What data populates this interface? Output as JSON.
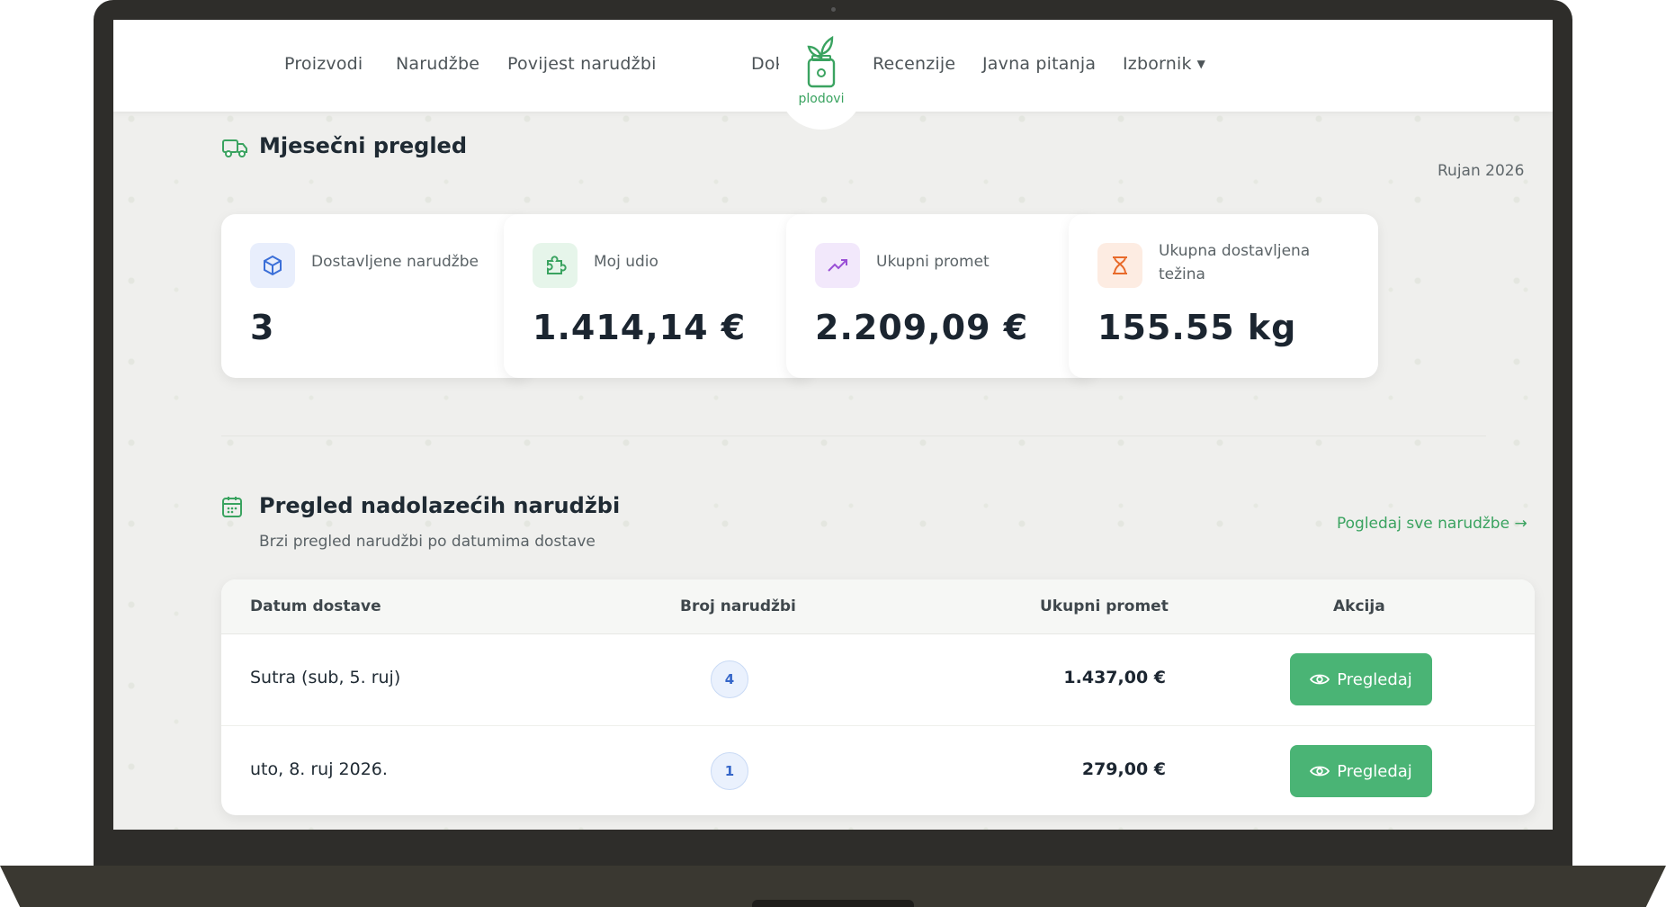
{
  "nav": {
    "items_left": [
      "Proizvodi",
      "Narudžbe",
      "Povijest narudžbi"
    ],
    "items_right": [
      "Dokumenti",
      "Recenzije",
      "Javna pitanja"
    ],
    "menu_label": "Izbornik",
    "logo_text": "plodovi"
  },
  "monthly": {
    "title": "Mjesečni pregled",
    "month": "Rujan 2026",
    "cards": [
      {
        "label": "Dostavljene narudžbe",
        "value": "3",
        "icon": "box-icon",
        "color": "#3b6fd8",
        "bg": "#e8eefc"
      },
      {
        "label": "Moj udio",
        "value": "1.414,14 €",
        "icon": "puzzle-icon",
        "color": "#3aa360",
        "bg": "#e6f5ea"
      },
      {
        "label": "Ukupni promet",
        "value": "2.209,09 €",
        "icon": "trending-up-icon",
        "color": "#9a4fd6",
        "bg": "#f2e8fb"
      },
      {
        "label": "Ukupna dostavljena težina",
        "value": "155.55 kg",
        "icon": "scale-icon",
        "color": "#e86a2a",
        "bg": "#fdece2"
      }
    ]
  },
  "upcoming": {
    "title": "Pregled nadolazećih narudžbi",
    "subtitle": "Brzi pregled narudžbi po datumima dostave",
    "view_all": "Pogledaj sve narudžbe →",
    "columns": [
      "Datum dostave",
      "Broj narudžbi",
      "Ukupni promet",
      "Akcija"
    ],
    "rows": [
      {
        "date": "Sutra (sub, 5. ruj)",
        "count": "4",
        "amount": "1.437,00 €",
        "action": "Pregledaj"
      },
      {
        "date": "uto, 8. ruj 2026.",
        "count": "1",
        "amount": "279,00 €",
        "action": "Pregledaj"
      }
    ]
  },
  "colors": {
    "accent": "#4ab475",
    "text": "#1b2530"
  }
}
